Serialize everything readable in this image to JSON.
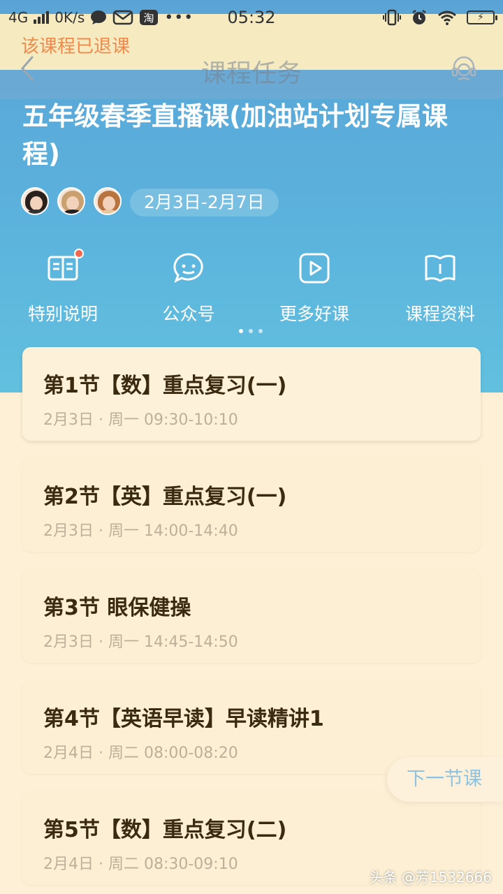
{
  "status_bar": {
    "network": "4G",
    "speed": "0K/s",
    "time": "05:32",
    "battery": "⚡"
  },
  "banner": {
    "withdrawn_notice": "该课程已退课"
  },
  "nav": {
    "title": "课程任务"
  },
  "course": {
    "title": "五年级春季直播课(加油站计划专属课程)",
    "date_range": "2月3日-2月7日"
  },
  "menu": [
    {
      "label": "特别说明",
      "icon": "book-icon"
    },
    {
      "label": "公众号",
      "icon": "chat-bubble-icon"
    },
    {
      "label": "更多好课",
      "icon": "play-icon"
    },
    {
      "label": "课程资料",
      "icon": "material-book-icon"
    }
  ],
  "lessons": [
    {
      "name": "第1节【数】重点复习(一)",
      "time": "2月3日 · 周一 09:30-10:10"
    },
    {
      "name": "第2节【英】重点复习(一)",
      "time": "2月3日 · 周一 14:00-14:40"
    },
    {
      "name": "第3节 眼保健操",
      "time": "2月3日 · 周一 14:45-14:50"
    },
    {
      "name": "第4节【英语早读】早读精讲1",
      "time": "2月4日 · 周二 08:00-08:20"
    },
    {
      "name": "第5节【数】重点复习(二)",
      "time": "2月4日 · 周二 08:30-09:10"
    }
  ],
  "next_lesson_label": "下一节课",
  "watermark": "头条 @芳1532666",
  "colors": {
    "hero_blue": "#5aa3d6",
    "card_bg": "#fcefd3",
    "notice_orange": "#f08a4b",
    "next_text": "#8ec3e0"
  }
}
